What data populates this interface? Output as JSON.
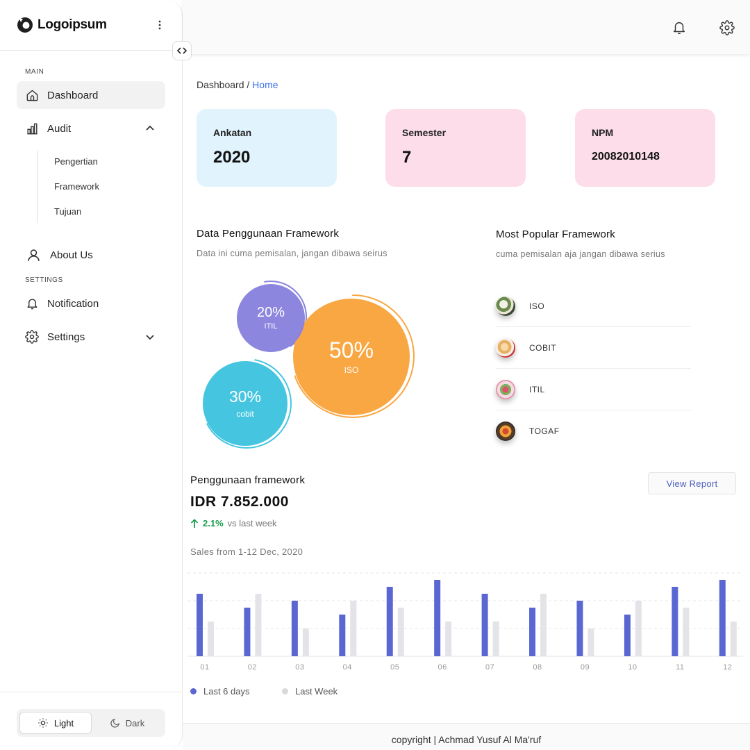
{
  "brand": {
    "name": "Logoipsum"
  },
  "sidebar": {
    "main_label": "MAIN",
    "settings_label": "SETTINGS",
    "items": {
      "dashboard": "Dashboard",
      "audit": "Audit",
      "about": "About Us",
      "notification": "Notification",
      "settings": "Settings"
    },
    "audit_sub": [
      "Pengertian",
      "Framework",
      "Tujuan"
    ],
    "theme": {
      "light": "Light",
      "dark": "Dark",
      "active": "light"
    }
  },
  "breadcrumb": {
    "root": "Dashboard",
    "separator": " / ",
    "current": "Home"
  },
  "cards": [
    {
      "label": "Ankatan",
      "value": "2020",
      "color": "#e1f3fd"
    },
    {
      "label": "Semester",
      "value": "7",
      "color": "#fcdde9"
    },
    {
      "label": "NPM",
      "value": "20082010148",
      "color": "#fcdde9"
    }
  ],
  "usage_data": {
    "title": "Data Penggunaan Framework",
    "subtitle": "Data ini cuma pemisalan, jangan dibawa seirus",
    "bubbles": [
      {
        "pct": "20%",
        "name": "ITIL",
        "color": "#8983de"
      },
      {
        "pct": "50%",
        "name": "ISO",
        "color": "#f9a743"
      },
      {
        "pct": "30%",
        "name": "cobit",
        "color": "#46c5e1"
      }
    ]
  },
  "popular": {
    "title": "Most Popular Framework",
    "subtitle": "cuma pemisalan aja jangan dibawa serius",
    "items": [
      "ISO",
      "COBIT",
      "ITIL",
      "TOGAF"
    ]
  },
  "sales": {
    "title": "Penggunaan framework",
    "amount": "IDR 7.852.000",
    "growth_pct": "2.1%",
    "growth_text": "vs last week",
    "view_report": "View Report",
    "range_label": "Sales from 1-12 Dec, 2020"
  },
  "chart_data": {
    "type": "bar",
    "categories": [
      "01",
      "02",
      "03",
      "04",
      "05",
      "06",
      "07",
      "08",
      "09",
      "10",
      "11",
      "12"
    ],
    "series": [
      {
        "name": "Last 6 days",
        "color": "#5a67d2",
        "values": [
          9,
          7,
          8,
          6,
          10,
          11,
          9,
          7,
          8,
          6,
          10,
          11
        ]
      },
      {
        "name": "Last Week",
        "color": "#e4e4e8",
        "values": [
          5,
          9,
          4,
          8,
          7,
          5,
          5,
          9,
          4,
          8,
          7,
          5
        ]
      }
    ],
    "ylim": [
      0,
      12
    ],
    "grid": true,
    "legend": "bottom-left"
  },
  "footer": {
    "text": "copyright | Achmad Yusuf Al Ma'ruf"
  }
}
